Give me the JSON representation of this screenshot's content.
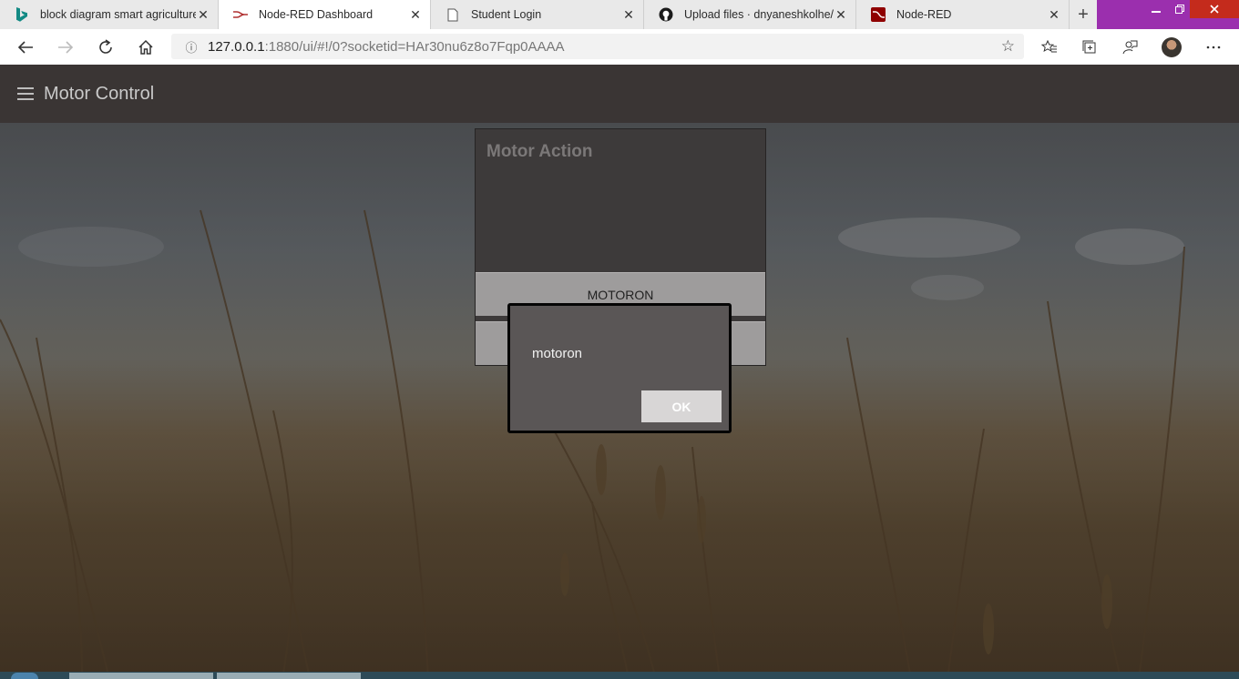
{
  "browser": {
    "tabs": [
      {
        "title": "block diagram smart agriculture",
        "icon": "bing-icon",
        "active": false
      },
      {
        "title": "Node-RED Dashboard",
        "icon": "node-red-icon",
        "active": true
      },
      {
        "title": "Student Login",
        "icon": "page-icon",
        "active": false
      },
      {
        "title": "Upload files · dnyaneshkolhe/H",
        "icon": "github-icon",
        "active": false
      },
      {
        "title": "Node-RED",
        "icon": "node-red-logo-icon",
        "active": false
      }
    ],
    "close_glyph": "✕",
    "new_tab_glyph": "+",
    "url_host": "127.0.0.1",
    "url_rest": ":1880/ui/#!/0?socketid=HAr30nu6z8o7Fqp0AAAA",
    "titlebar_color": "#9b2fae"
  },
  "dashboard": {
    "title": "Motor Control",
    "group_title": "Motor Action",
    "buttons": [
      {
        "label": "MOTORON"
      },
      {
        "label": ""
      }
    ]
  },
  "dialog": {
    "message": "motoron",
    "ok_label": "OK"
  }
}
